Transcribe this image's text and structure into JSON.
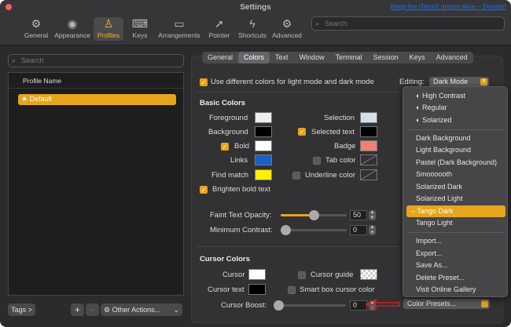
{
  "window": {
    "title": "Settings",
    "promo_link": "Keep the iTerm2 dream alive – Donate!",
    "traffic_light_colors": [
      "#fc5f57",
      "#fdbc2e",
      "#28c840"
    ]
  },
  "toolbar": {
    "items": [
      {
        "label": "General",
        "icon": "gear-icon"
      },
      {
        "label": "Appearance",
        "icon": "eye-icon"
      },
      {
        "label": "Profiles",
        "icon": "person-icon",
        "selected": true
      },
      {
        "label": "Keys",
        "icon": "keyboard-icon"
      },
      {
        "label": "Arrangements",
        "icon": "window-icon"
      },
      {
        "label": "Pointer",
        "icon": "pointer-icon"
      },
      {
        "label": "Shortcuts",
        "icon": "bolt-icon"
      },
      {
        "label": "Advanced",
        "icon": "gear-advanced-icon"
      }
    ],
    "search_placeholder": "Search"
  },
  "profiles": {
    "search_placeholder": "Search",
    "column_header": "Profile Name",
    "items": [
      {
        "name": "Default",
        "default": true
      }
    ],
    "tags_button": "Tags >",
    "add_button": "+",
    "remove_button": "−",
    "other_actions": "Other Actions..."
  },
  "tabs": [
    "General",
    "Colors",
    "Text",
    "Window",
    "Terminal",
    "Session",
    "Keys",
    "Advanced"
  ],
  "active_tab": "Colors",
  "colors": {
    "use_diff_label": "Use different colors for light mode and dark mode",
    "use_diff_checked": true,
    "editing_label": "Editing:",
    "editing_value": "Dark Mode",
    "basic_header": "Basic Colors",
    "foreground": {
      "label": "Foreground",
      "color": "#eeeeee"
    },
    "background": {
      "label": "Background",
      "color": "#000000"
    },
    "bold": {
      "label": "Bold",
      "color": "#ffffff",
      "checked": true
    },
    "links": {
      "label": "Links",
      "color": "#1a5fc4"
    },
    "find_match": {
      "label": "Find match",
      "color": "#fff000"
    },
    "brighten_bold": {
      "label": "Brighten bold text",
      "checked": true
    },
    "selection": {
      "label": "Selection",
      "color": "#d5dfe9"
    },
    "selected_text": {
      "label": "Selected text",
      "color": "#000000",
      "checked": true
    },
    "badge": {
      "label": "Badge",
      "color": "#f07f76"
    },
    "tab_color": {
      "label": "Tab color",
      "checked": false
    },
    "underline_color": {
      "label": "Underline color",
      "checked": false
    },
    "faint_opacity": {
      "label": "Faint Text Opacity:",
      "value": "50",
      "fraction": 0.5
    },
    "min_contrast": {
      "label": "Minimum Contrast:",
      "value": "0",
      "fraction": 0
    },
    "cursor_header": "Cursor Colors",
    "cursor": {
      "label": "Cursor",
      "color": "#ffffff"
    },
    "cursor_text": {
      "label": "Cursor text",
      "color": "#000000"
    },
    "cursor_guide": {
      "label": "Cursor guide",
      "checked": false
    },
    "smart_box": {
      "label": "Smart box cursor color",
      "checked": false
    },
    "cursor_boost": {
      "label": "Cursor Boost:",
      "value": "0",
      "fraction": 0
    },
    "presets_button": "Color Presets..."
  },
  "presets_menu": {
    "builtin": [
      {
        "label": "High Contrast",
        "icon": "half-circle-icon"
      },
      {
        "label": "Regular",
        "icon": "half-circle-icon"
      },
      {
        "label": "Solarized",
        "icon": "half-circle-icon"
      }
    ],
    "presets": [
      "Dark Background",
      "Light Background",
      "Pastel (Dark Background)",
      "Smoooooth",
      "Solarized Dark",
      "Solarized Light",
      "Tango Dark",
      "Tango Light"
    ],
    "selected": "Tango Dark",
    "actions": [
      "Import...",
      "Export...",
      "Save As...",
      "Delete Preset...",
      "Visit Online Gallery"
    ]
  }
}
